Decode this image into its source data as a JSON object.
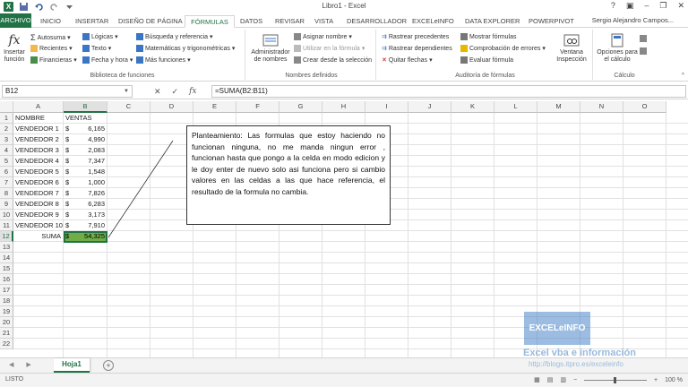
{
  "window": {
    "title": "Libro1 - Excel",
    "user": "Sergio Alejandro Campos..."
  },
  "tabs": [
    "ARCHIVO",
    "INICIO",
    "INSERTAR",
    "DISEÑO DE PÁGINA",
    "FÓRMULAS",
    "DATOS",
    "REVISAR",
    "VISTA",
    "DESARROLLADOR",
    "EXCELeINFO",
    "DATA EXPLORER",
    "POWERPIVOT"
  ],
  "ribbon": {
    "insert_function": "Insertar función",
    "autosuma": "Autosuma",
    "recientes": "Recientes",
    "financieras": "Financieras",
    "logicas": "Lógicas",
    "texto": "Texto",
    "fecha_hora": "Fecha y hora",
    "busqueda": "Búsqueda y referencia",
    "matematicas": "Matemáticas y trigonométricas",
    "mas_funciones": "Más funciones",
    "group_biblioteca": "Biblioteca de funciones",
    "administrador": "Administrador de nombres",
    "asignar_nombre": "Asignar nombre",
    "utilizar_formula": "Utilizar en la fórmula",
    "crear_seleccion": "Crear desde la selección",
    "group_nombres": "Nombres definidos",
    "rastrear_precedentes": "Rastrear precedentes",
    "rastrear_dependientes": "Rastrear dependientes",
    "quitar_flechas": "Quitar flechas",
    "mostrar_formulas": "Mostrar fórmulas",
    "comprobacion_errores": "Comprobación de errores",
    "evaluar_formula": "Evaluar fórmula",
    "ventana_inspeccion": "Ventana Inspección",
    "group_auditoria": "Auditoría de fórmulas",
    "opciones_calculo": "Opciones para el cálculo",
    "group_calculo": "Cálculo"
  },
  "formula_bar": {
    "name_box": "B12",
    "formula": "=SUMA(B2:B11)"
  },
  "columns": [
    "A",
    "B",
    "C",
    "D",
    "E",
    "F",
    "G",
    "H",
    "I",
    "J",
    "K",
    "L",
    "M",
    "N",
    "O"
  ],
  "rows": [
    "1",
    "2",
    "3",
    "4",
    "5",
    "6",
    "7",
    "8",
    "9",
    "10",
    "11",
    "12",
    "13",
    "14",
    "15",
    "16",
    "17",
    "18",
    "19",
    "20",
    "21",
    "22"
  ],
  "table": {
    "header": [
      "NOMBRE",
      "VENTAS"
    ],
    "rows": [
      {
        "name": "VENDEDOR 1",
        "currency": "$",
        "value": "6,165"
      },
      {
        "name": "VENDEDOR 2",
        "currency": "$",
        "value": "4,990"
      },
      {
        "name": "VENDEDOR 3",
        "currency": "$",
        "value": "2,083"
      },
      {
        "name": "VENDEDOR 4",
        "currency": "$",
        "value": "7,347"
      },
      {
        "name": "VENDEDOR 5",
        "currency": "$",
        "value": "1,548"
      },
      {
        "name": "VENDEDOR 6",
        "currency": "$",
        "value": "1,000"
      },
      {
        "name": "VENDEDOR 7",
        "currency": "$",
        "value": "7,826"
      },
      {
        "name": "VENDEDOR 8",
        "currency": "$",
        "value": "6,283"
      },
      {
        "name": "VENDEDOR 9",
        "currency": "$",
        "value": "3,173"
      },
      {
        "name": "VENDEDOR 10",
        "currency": "$",
        "value": "7,910"
      }
    ],
    "total_label": "SUMA",
    "total_currency": "$",
    "total_value": "54,325"
  },
  "note": "Planteamiento: Las formulas que estoy haciendo no funcionan ninguna, no me manda ningun error , funcionan hasta que pongo a la celda en modo edicion y le doy enter de nuevo solo asi funciona pero si cambio valores en las celdas a las que hace referencia, el resultado de la formula no cambia.",
  "sheets": [
    "Hoja1"
  ],
  "status": {
    "mode": "LISTO",
    "zoom": "100 %"
  },
  "watermark": {
    "logo": "EXCELeINFO",
    "tagline": "Excel vba e información",
    "url": "http://blogs.itpro.es/exceleinfo"
  },
  "colors": {
    "excel_green": "#217346",
    "selection_fill": "#70ad47"
  }
}
